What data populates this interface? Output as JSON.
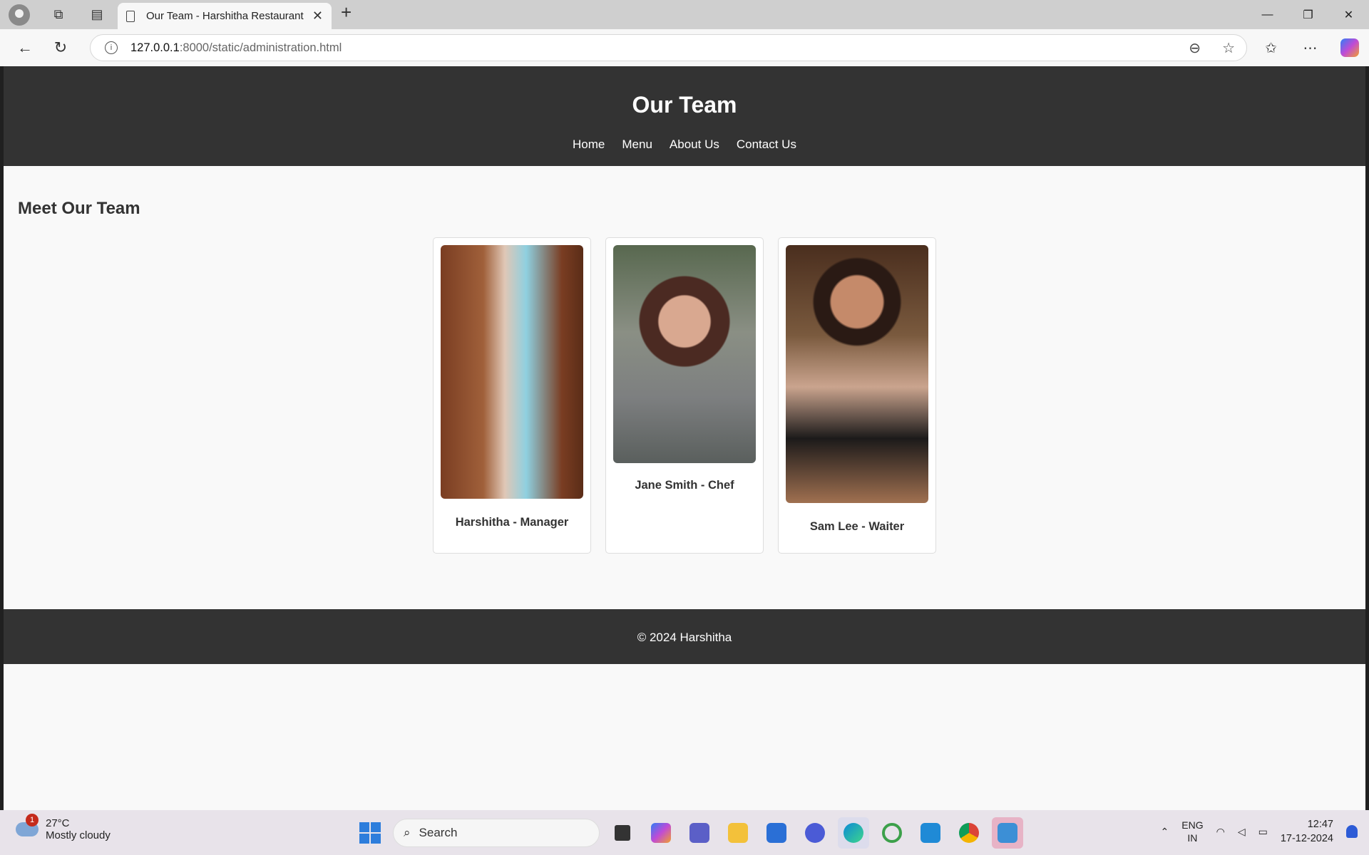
{
  "browser": {
    "tab_title": "Our Team - Harshitha Restaurant",
    "url_host": "127.0.0.1",
    "url_path": ":8000/static/administration.html"
  },
  "page": {
    "header_title": "Our Team",
    "nav": [
      "Home",
      "Menu",
      "About Us",
      "Contact Us"
    ],
    "section_title": "Meet Our Team",
    "team": [
      {
        "name": "Harshitha - Manager"
      },
      {
        "name": "Jane Smith - Chef"
      },
      {
        "name": "Sam Lee - Waiter"
      }
    ],
    "footer": "© 2024 Harshitha"
  },
  "taskbar": {
    "weather_temp": "27°C",
    "weather_desc": "Mostly cloudy",
    "weather_badge": "1",
    "search_label": "Search",
    "lang_1": "ENG",
    "lang_2": "IN",
    "time": "12:47",
    "date": "17-12-2024"
  }
}
